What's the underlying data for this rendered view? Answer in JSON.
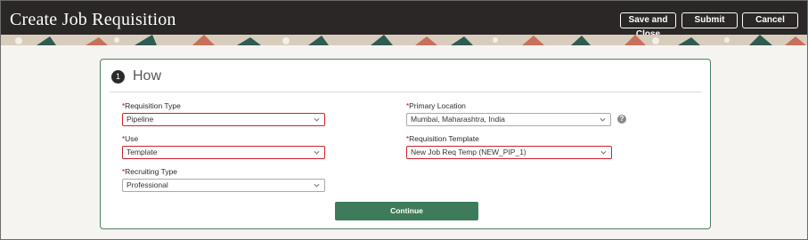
{
  "header": {
    "title": "Create Job Requisition",
    "save_close_label": "Save and Close",
    "submit_label": "Submit",
    "cancel_label": "Cancel"
  },
  "section": {
    "number": "1",
    "title": "How"
  },
  "fields": {
    "requisition_type": {
      "label": "Requisition Type",
      "value": "Pipeline"
    },
    "use": {
      "label": "Use",
      "value": "Template"
    },
    "recruiting_type": {
      "label": "Recruiting Type",
      "value": "Professional"
    },
    "primary_location": {
      "label": "Primary Location",
      "value": "Mumbai, Maharashtra, India"
    },
    "requisition_template": {
      "label": "Requisition Template",
      "value": "New Job Req Temp (NEW_PIP_1)"
    }
  },
  "required_marker": "*",
  "help_icon_text": "?",
  "continue_label": "Continue",
  "colors": {
    "header_bg": "#2b2727",
    "accent_green": "#3e7b5a",
    "highlight_red": "#d0202a"
  },
  "icons": [
    "chevron-down-icon",
    "help-icon"
  ]
}
